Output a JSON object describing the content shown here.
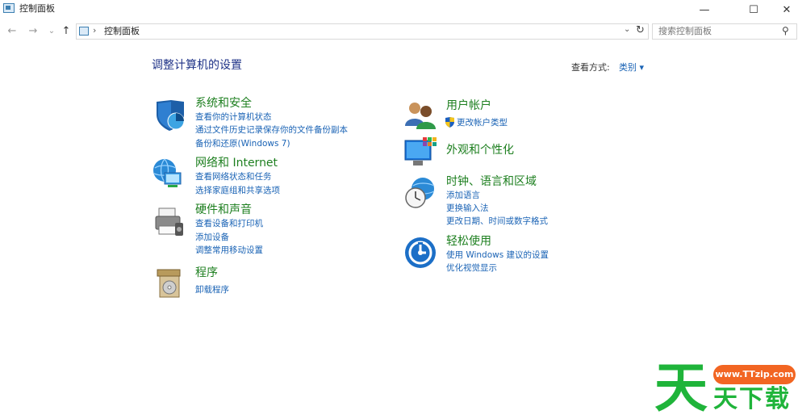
{
  "window": {
    "title": "控制面板",
    "minimize_glyph": "—",
    "maximize_glyph": "☐",
    "close_glyph": "✕"
  },
  "navbar": {
    "back_glyph": "←",
    "forward_glyph": "→",
    "recent_glyph": "⌄",
    "up_glyph": "↑",
    "address_separator": "›",
    "address_text": "控制面板",
    "dropdown_glyph": "⌄",
    "refresh_glyph": "↻",
    "search_placeholder": "搜索控制面板",
    "search_glyph": "⚲"
  },
  "main": {
    "title": "调整计算机的设置",
    "view_by_label": "查看方式:",
    "view_by_value": "类别 ▾"
  },
  "categories_left": [
    {
      "title": "系统和安全",
      "links": [
        "查看你的计算机状态",
        "通过文件历史记录保存你的文件备份副本",
        "备份和还原(Windows 7)"
      ]
    },
    {
      "title": "网络和 Internet",
      "links": [
        "查看网络状态和任务",
        "选择家庭组和共享选项"
      ]
    },
    {
      "title": "硬件和声音",
      "links": [
        "查看设备和打印机",
        "添加设备",
        "调整常用移动设置"
      ]
    },
    {
      "title": "程序",
      "links": [
        "卸载程序"
      ]
    }
  ],
  "categories_right": [
    {
      "title": "用户帐户",
      "links": [
        "更改帐户类型"
      ]
    },
    {
      "title": "外观和个性化",
      "links": []
    },
    {
      "title": "时钟、语言和区域",
      "links": [
        "添加语言",
        "更换输入法",
        "更改日期、时间或数字格式"
      ]
    },
    {
      "title": "轻松使用",
      "links": [
        "使用 Windows 建议的设置",
        "优化视觉显示"
      ]
    }
  ],
  "watermark": {
    "url": "www.TTzip.com",
    "big_char": "天",
    "text": "天下载"
  },
  "colors": {
    "link": "#1a63b5",
    "category_title": "#1d7f1f",
    "page_title": "#1e3287",
    "watermark_green": "#1fb43a",
    "watermark_orange": "#f26522"
  }
}
